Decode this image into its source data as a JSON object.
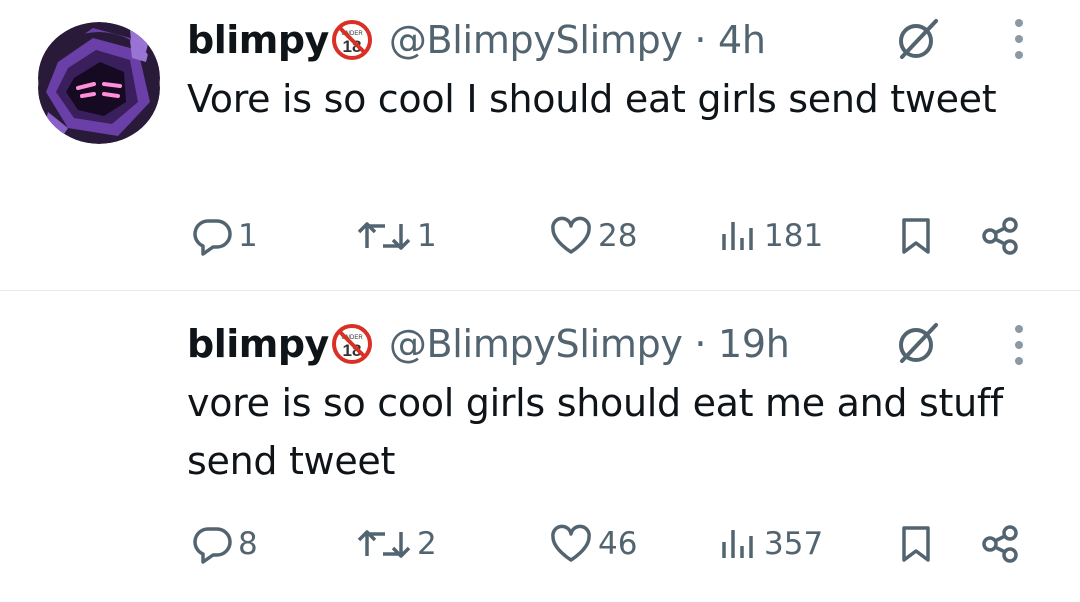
{
  "tweets": [
    {
      "display_name": "blimpy",
      "handle": "@BlimpySlimpy",
      "time": "4h",
      "text": "Vore is so cool I should eat girls send tweet",
      "replies": "1",
      "reposts": "1",
      "likes": "28",
      "views": "181",
      "badge_text": "UNDER"
    },
    {
      "display_name": "blimpy",
      "handle": "@BlimpySlimpy",
      "time": "19h",
      "text": "vore is so cool girls should eat me and stuff send tweet",
      "replies": "8",
      "reposts": "2",
      "likes": "46",
      "views": "357",
      "badge_text": "UNDER"
    }
  ],
  "separator": " · ",
  "icons": {
    "badge": "under-18-badge-icon",
    "grok": "grok-icon",
    "more": "more-vertical-icon",
    "reply": "reply-icon",
    "repost": "repost-icon",
    "like": "heart-icon",
    "views": "views-icon",
    "bookmark": "bookmark-icon",
    "share": "share-icon"
  },
  "colors": {
    "text": "#0f1419",
    "secondary": "#536471",
    "badge_red": "#d93025",
    "avatar_purple": "#6a3fa8"
  }
}
